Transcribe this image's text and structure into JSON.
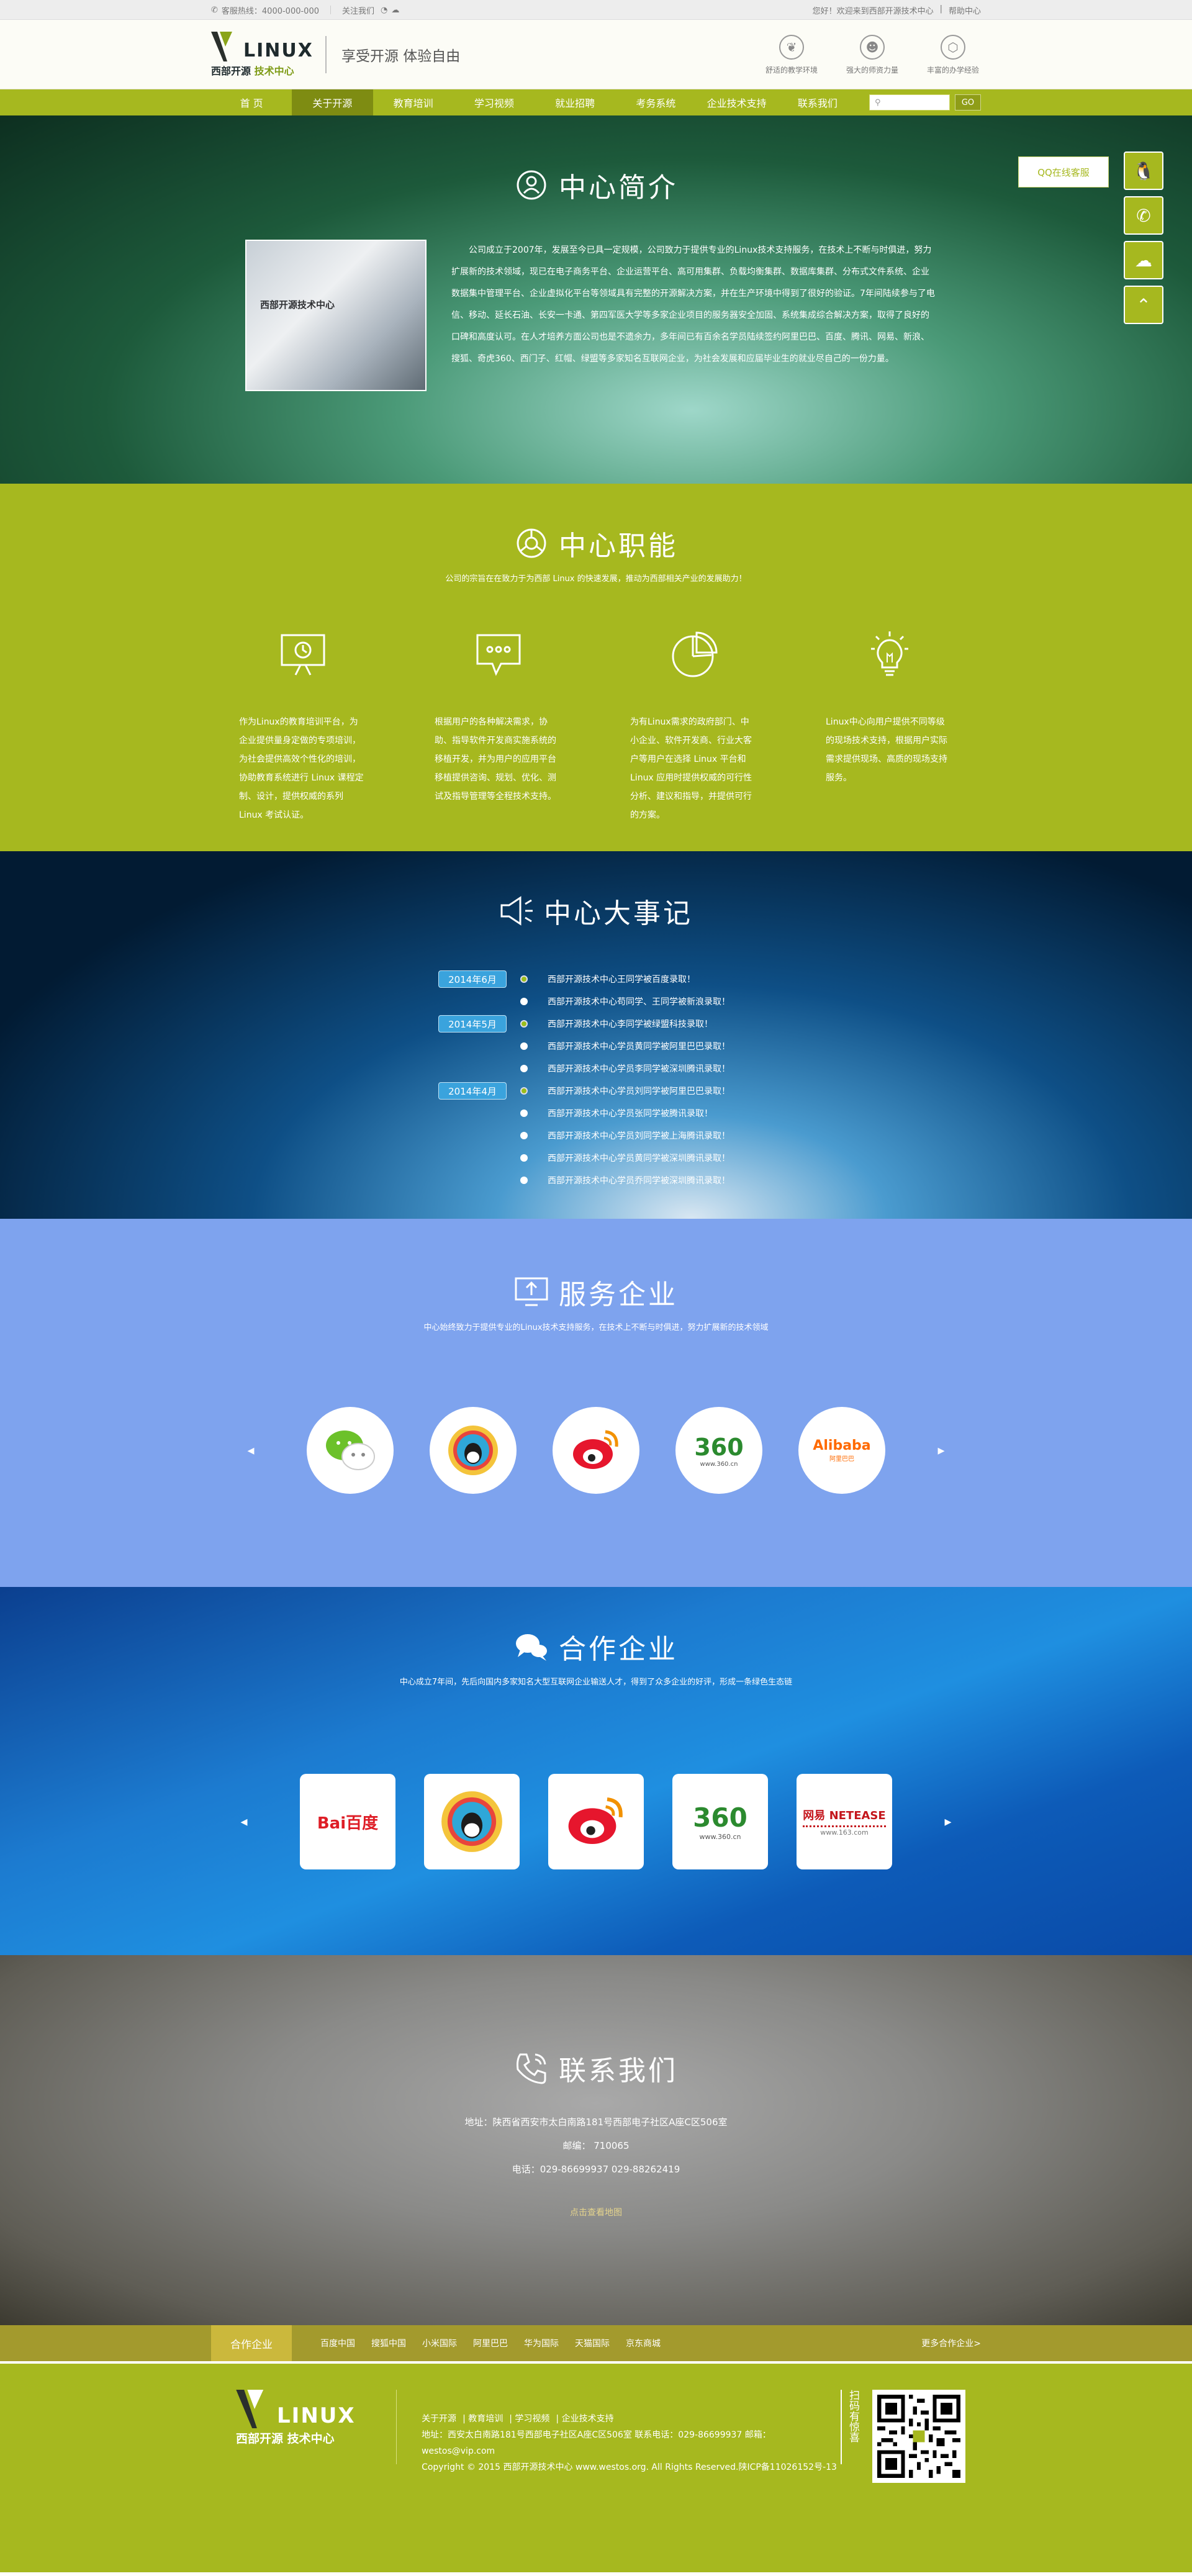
{
  "topbar": {
    "phone": "客服热线：4000-000-000",
    "follow": "关注我们",
    "right_links": [
      "您好！欢迎来到西部开源技术中心",
      "帮助中心"
    ]
  },
  "header": {
    "logo_word": "LINUX",
    "logo_sub_a": "西部开源",
    "logo_sub_b": "技术中心",
    "slogan": "享受开源 体验自由",
    "features": [
      {
        "icon": "plant-icon",
        "label": "舒适的教学环境"
      },
      {
        "icon": "team-icon",
        "label": "强大的师资力量"
      },
      {
        "icon": "cube-icon",
        "label": "丰富的办学经验"
      }
    ]
  },
  "nav": {
    "items": [
      "首 页",
      "关于开源",
      "教育培训",
      "学习视频",
      "就业招聘",
      "考务系统",
      "企业技术支持",
      "联系我们"
    ],
    "active_index": 1,
    "search_placeholder": "",
    "search_button": "GO"
  },
  "floatbar": {
    "qq_label": "QQ在线客服",
    "buttons": [
      "qq-icon",
      "phone-icon",
      "wechat-icon",
      "up-arrow-icon"
    ]
  },
  "intro": {
    "title": "中心简介",
    "photo_sign": "西部开源技术中心",
    "text": "公司成立于2007年，发展至今已具一定规模，公司致力于提供专业的Linux技术支持服务，在技术上不断与时俱进，努力扩展新的技术领域，现已在电子商务平台、企业运营平台、高可用集群、负载均衡集群、数据库集群、分布式文件系统、企业数据集中管理平台、企业虚拟化平台等领域具有完整的开源解决方案，并在生产环境中得到了很好的验证。7年间陆续参与了电信、移动、延长石油、长安一卡通、第四军医大学等多家企业项目的服务器安全加固、系统集成综合解决方案，取得了良好的口碑和高度认可。在人才培养方面公司也是不遗余力，多年间已有百余名学员陆续签约阿里巴巴、百度、腾讯、网易、新浪、搜狐、奇虎360、西门子、红帽、绿盟等多家知名互联网企业，为社会发展和应届毕业生的就业尽自己的一份力量。"
  },
  "functions": {
    "title": "中心职能",
    "subtitle": "公司的宗旨在在致力于为西部 Linux 的快速发展，推动为西部相关产业的发展助力！",
    "items": [
      {
        "icon": "presentation-icon",
        "text": "作为Linux的教育培训平台，为企业提供量身定做的专项培训，为社会提供高效个性化的培训，协助教育系统进行 Linux 课程定制、设计，提供权威的系列 Linux 考试认证。"
      },
      {
        "icon": "chat-bubble-icon",
        "text": "根据用户的各种解决需求，协助、指导软件开发商实施系统的移植开发，并为用户的应用平台移植提供咨询、规划、优化、测试及指导管理等全程技术支持。"
      },
      {
        "icon": "pie-chart-icon",
        "text": "为有Linux需求的政府部门、中小企业、软件开发商、行业大客户等用户在选择 Linux 平台和 Linux 应用时提供权威的可行性分析、建议和指导，并提供可行的方案。"
      },
      {
        "icon": "lightbulb-icon",
        "text": "Linux中心向用户提供不同等级的现场技术支持，根据用户实际需求提供现场、高质的现场支持服务。"
      }
    ]
  },
  "events": {
    "title": "中心大事记",
    "rows": [
      {
        "badge": "2014年6月",
        "dot": "green",
        "text": "西部开源技术中心王同学被百度录取！"
      },
      {
        "badge": "",
        "dot": "white",
        "text": "西部开源技术中心苟同学、王同学被新浪录取！"
      },
      {
        "badge": "2014年5月",
        "dot": "green",
        "text": "西部开源技术中心李同学被绿盟科技录取！"
      },
      {
        "badge": "",
        "dot": "white",
        "text": "西部开源技术中心学员黄同学被阿里巴巴录取！"
      },
      {
        "badge": "",
        "dot": "white",
        "text": "西部开源技术中心学员李同学被深圳腾讯录取！"
      },
      {
        "badge": "2014年4月",
        "dot": "green",
        "text": "西部开源技术中心学员刘同学被阿里巴巴录取！"
      },
      {
        "badge": "",
        "dot": "white",
        "text": "西部开源技术中心学员张同学被腾讯录取！"
      },
      {
        "badge": "",
        "dot": "white",
        "text": "西部开源技术中心学员刘同学被上海腾讯录取！"
      },
      {
        "badge": "",
        "dot": "white",
        "text": "西部开源技术中心学员黄同学被深圳腾讯录取！"
      },
      {
        "badge": "",
        "dot": "white",
        "text": "西部开源技术中心学员乔同学被深圳腾讯录取！"
      }
    ]
  },
  "service": {
    "title": "服务企业",
    "subtitle": "中心始终致力于提供专业的Linux技术支持服务，在技术上不断与时俱进，努力扩展新的技术领域",
    "logos": [
      {
        "name": "wechat-logo",
        "label": ""
      },
      {
        "name": "qq-logo",
        "label": ""
      },
      {
        "name": "weibo-logo",
        "label": ""
      },
      {
        "name": "360-logo",
        "label": "360",
        "sub": "www.360.cn"
      },
      {
        "name": "alibaba-logo",
        "label": "Alibaba",
        "sub": "阿里巴巴"
      }
    ]
  },
  "partners": {
    "title": "合作企业",
    "subtitle": "中心成立7年间，先后向国内多家知名大型互联网企业输送人才，得到了众多企业的好评，形成一条绿色生态链",
    "logos": [
      {
        "name": "baidu-logo",
        "label": "Bai百度"
      },
      {
        "name": "qq-logo",
        "label": ""
      },
      {
        "name": "weibo-logo",
        "label": ""
      },
      {
        "name": "360-logo",
        "label": "360",
        "sub": "www.360.cn"
      },
      {
        "name": "netease-logo",
        "label": "网易 NETEASE",
        "sub": "www.163.com"
      }
    ]
  },
  "contact": {
    "title": "联系我们",
    "address": "地址：陕西省西安市太白南路181号西部电子社区A座C区506室",
    "postcode": "邮编： 710065",
    "phone": "电话：029-86699937 029-88262419",
    "map_link": "点击查看地图"
  },
  "pstrip": {
    "label": "合作企业",
    "links": [
      "百度中国",
      "搜狐中国",
      "小米国际",
      "阿里巴巴",
      "华为国际",
      "天猫国际",
      "京东商城"
    ],
    "more": "更多合作企业>"
  },
  "footer": {
    "links": [
      "关于开源",
      "教育培训",
      "学习视频",
      "企业技术支持"
    ],
    "address": "地址：西安太白南路181号西部电子社区A座C区506室  联系电话：029-86699937  邮箱：westos@vip.com",
    "copyright": "Copyright © 2015 西部开源技术中心 www.westos.org. All Rights Reserved.陕ICP备11026152号-13",
    "qr_label": "扫码有惊喜"
  },
  "colors": {
    "accent": "#a6b81f",
    "accent_dark": "#7e8c12",
    "service_bg": "#7ea3ee"
  }
}
